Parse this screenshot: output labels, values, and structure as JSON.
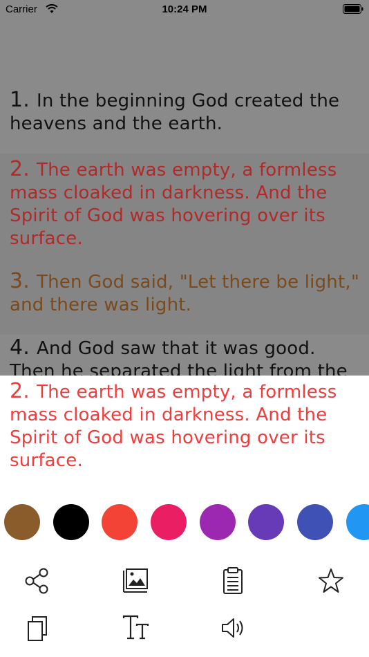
{
  "status_bar": {
    "carrier": "Carrier",
    "time": "10:24 PM"
  },
  "reader": {
    "verses": [
      {
        "number": "1.",
        "text": "In the beginning God created the heavens and the earth.",
        "color": "#111111"
      },
      {
        "number": "2.",
        "text": "The earth was empty, a formless mass cloaked in darkness. And the Spirit of God was hovering over its surface.",
        "color": "#b02a2a"
      },
      {
        "number": "3.",
        "text": "Then God said, \"Let there be light,\" and there was light.",
        "color": "#7a4a1c"
      },
      {
        "number": "4.",
        "text": "And God saw that it was good. Then he separated the light from the",
        "color": "#111111"
      }
    ]
  },
  "sheet": {
    "preview": {
      "number": "2.",
      "text": "The earth was empty, a formless mass cloaked in darkness. And the Spirit of God was hovering over its surface.",
      "color": "#f23b3b"
    },
    "palette": [
      {
        "name": "brown",
        "color": "#8a5c2b"
      },
      {
        "name": "black",
        "color": "#000000"
      },
      {
        "name": "red",
        "color": "#f34336"
      },
      {
        "name": "pink",
        "color": "#e91e63"
      },
      {
        "name": "purple",
        "color": "#9c27b0"
      },
      {
        "name": "deep-purple",
        "color": "#673ab7"
      },
      {
        "name": "indigo",
        "color": "#3f51b5"
      },
      {
        "name": "blue",
        "color": "#2196f3"
      }
    ],
    "toolbar": {
      "row1": [
        {
          "name": "share",
          "icon": "share-icon"
        },
        {
          "name": "image",
          "icon": "image-icon"
        },
        {
          "name": "clipboard",
          "icon": "clipboard-icon"
        },
        {
          "name": "bookmark",
          "icon": "star-icon"
        }
      ],
      "row2": [
        {
          "name": "copy",
          "icon": "copy-icon"
        },
        {
          "name": "font-size",
          "icon": "text-size-icon"
        },
        {
          "name": "speak",
          "icon": "speaker-icon"
        }
      ]
    }
  }
}
